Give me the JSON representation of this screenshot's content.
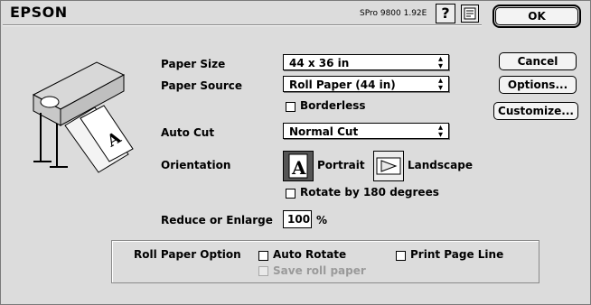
{
  "header": {
    "brand": "EPSON",
    "version": "SPro 9800 1.92E",
    "help_label": "?"
  },
  "buttons": {
    "ok": "OK",
    "cancel": "Cancel",
    "options": "Options...",
    "customize": "Customize..."
  },
  "fields": {
    "paper_size": {
      "label": "Paper Size",
      "value": "44 x 36 in"
    },
    "paper_source": {
      "label": "Paper Source",
      "value": "Roll Paper (44 in)"
    },
    "borderless": {
      "label": "Borderless",
      "checked": false
    },
    "auto_cut": {
      "label": "Auto Cut",
      "value": "Normal Cut"
    },
    "orientation": {
      "label": "Orientation",
      "portrait": "Portrait",
      "landscape": "Landscape",
      "selected": "Portrait"
    },
    "rotate180": {
      "label": "Rotate by 180 degrees",
      "checked": false
    },
    "reduce_enlarge": {
      "label": "Reduce or Enlarge",
      "value": "100",
      "unit": "%"
    }
  },
  "roll_paper": {
    "title": "Roll Paper Option",
    "auto_rotate": {
      "label": "Auto Rotate",
      "checked": false
    },
    "print_page_line": {
      "label": "Print Page Line",
      "checked": false
    },
    "save_roll_paper": {
      "label": "Save roll paper",
      "checked": false,
      "disabled": true
    }
  },
  "icons": {
    "popup_arrows": "⬍",
    "help": "question-icon",
    "printer_info": "printer-info-icon",
    "illustration": "printer-illustration",
    "portrait": "portrait-icon",
    "landscape": "landscape-icon"
  }
}
